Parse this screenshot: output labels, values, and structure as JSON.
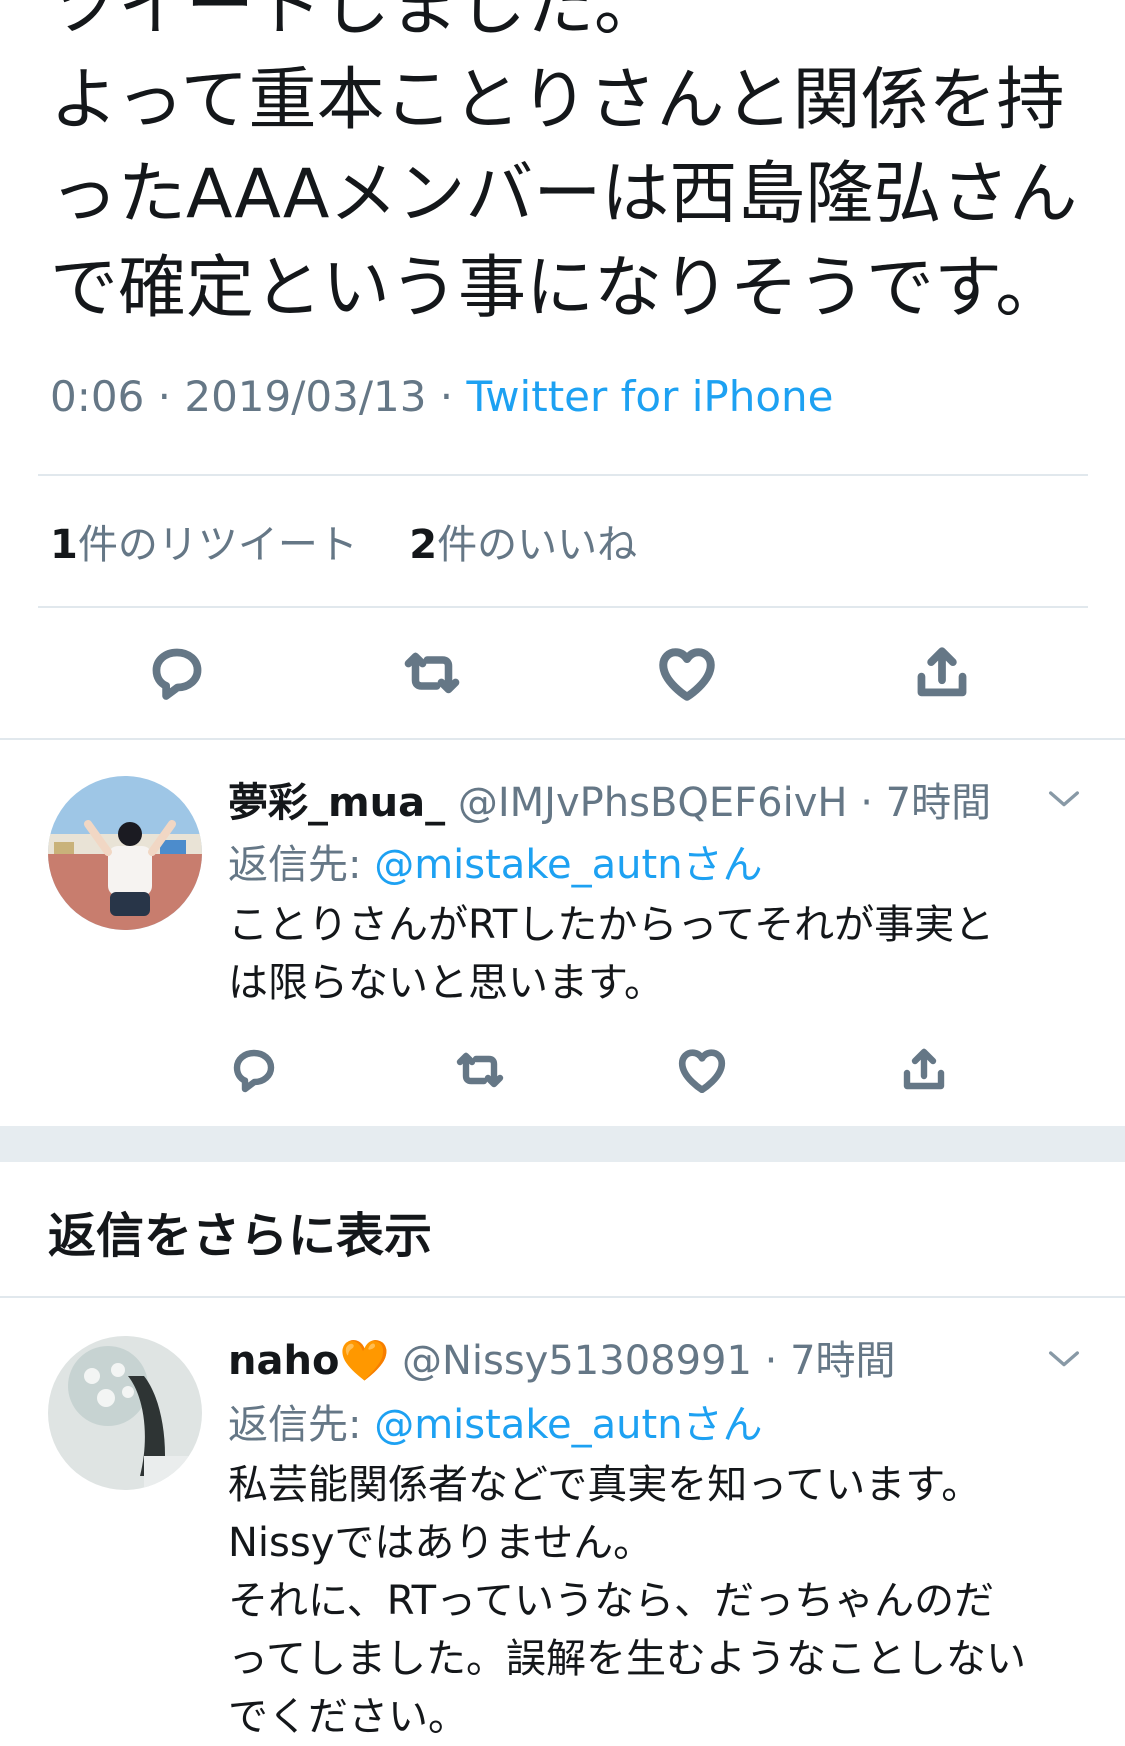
{
  "tweet": {
    "text": "ツイートしました。\nよって重本ことりさんと関係を持\nったAAAメンバーは西島隆弘さん\nで確定という事になりそうです。",
    "time": "0:06 · 2019/03/13 · ",
    "source": "Twitter for iPhone",
    "retweets_count": "1",
    "retweets_label": "件のリツイート",
    "likes_count": "2",
    "likes_label": "件のいいね"
  },
  "icons": [
    "reply-icon",
    "retweet-icon",
    "like-icon",
    "share-icon",
    "chevron-down-icon"
  ],
  "replies": [
    {
      "name": "夢彩_mua_",
      "handle": "@IMJvPhsBQEF6ivH",
      "time": "· 7時間",
      "reply_label": "返信先: ",
      "reply_to": "@mistake_autnさん",
      "text": "ことりさんがRTしたからってそれが事実と\nは限らないと思います。"
    },
    {
      "name": "naho",
      "emoji": "🧡",
      "handle": "@Nissy51308991",
      "time": "· 7時間",
      "reply_label": "返信先: ",
      "reply_to": "@mistake_autnさん",
      "text": "私芸能関係者などで真実を知っています。\nNissyではありません。\nそれに、RTっていうなら、だっちゃんのだ\nってしました。誤解を生むようなことしない\nでください。"
    }
  ],
  "more_replies_label": "返信をさらに表示",
  "colors": {
    "link": "#1da1f2",
    "muted": "#657786",
    "divider": "#e1e8ed",
    "gap": "#e6ecf0"
  }
}
